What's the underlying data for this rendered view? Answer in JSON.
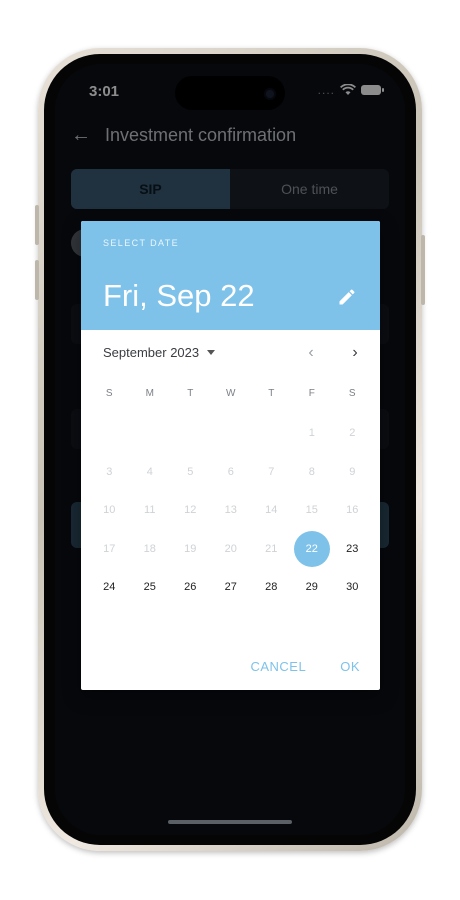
{
  "status_bar": {
    "time": "3:01",
    "dots": "...."
  },
  "header": {
    "title": "Investment confirmation",
    "back_icon": "←"
  },
  "segment": {
    "options": [
      "SIP",
      "One time"
    ],
    "selected": "SIP"
  },
  "colors": {
    "accent": "#7ec2ea",
    "background": "#0b0f17",
    "segment_active": "#3b5b73"
  },
  "date_picker": {
    "label": "SELECT DATE",
    "selected_display": "Fri, Sep 22",
    "month_label": "September 2023",
    "weekdays": [
      "S",
      "M",
      "T",
      "W",
      "T",
      "F",
      "S"
    ],
    "first_weekday_index": 5,
    "days_in_month": 30,
    "selected_day": 22,
    "first_enabled_day": 22,
    "icons": {
      "edit": "pencil-icon",
      "prev": "chevron-left-icon",
      "next": "chevron-right-icon",
      "month_dropdown": "caret-down-icon"
    },
    "prev_symbol": "‹",
    "next_symbol": "›",
    "cancel_label": "CANCEL",
    "ok_label": "OK"
  }
}
